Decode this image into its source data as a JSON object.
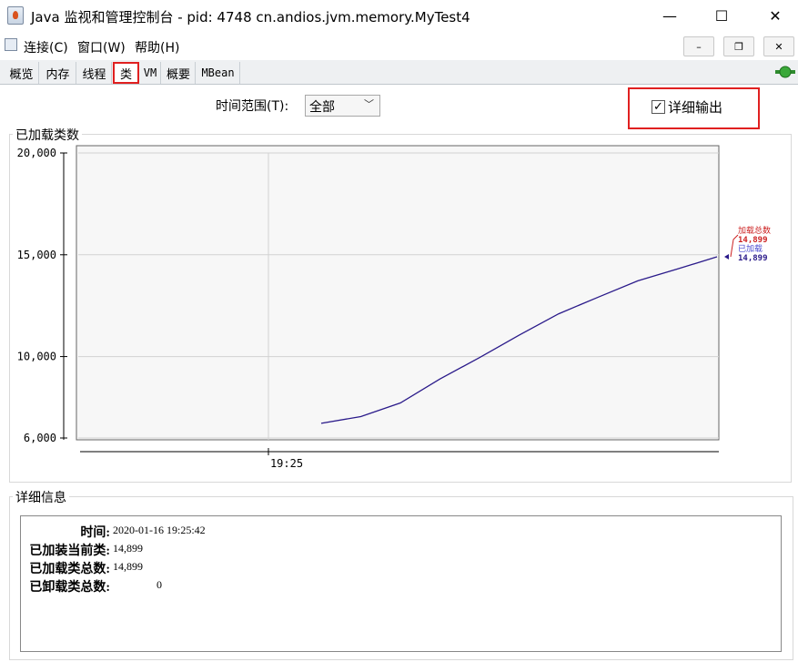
{
  "window": {
    "title": "Java 监视和管理控制台 - pid: 4748 cn.andios.jvm.memory.MyTest4",
    "minimize": "—",
    "maximize": "☐",
    "close": "✕"
  },
  "menubar": {
    "items": [
      "连接(C)",
      "窗口(W)",
      "帮助(H)"
    ],
    "mdi_minimize": "–",
    "mdi_restore": "❐",
    "mdi_close": "✕"
  },
  "tabs": [
    {
      "label": "概览"
    },
    {
      "label": "内存"
    },
    {
      "label": "线程"
    },
    {
      "label": "类"
    },
    {
      "label": "VM"
    },
    {
      "label": "概要"
    },
    {
      "label": "MBean"
    }
  ],
  "toolbar": {
    "range_label": "时间范围(T):",
    "range_value": "全部",
    "verbose_label": "详细输出",
    "verbose_checked": "✓"
  },
  "chart_group_title": "已加载类数",
  "chart_data": {
    "type": "line",
    "ylim": [
      6000,
      20000
    ],
    "yticks": [
      {
        "value": 20000,
        "label": "20,000"
      },
      {
        "value": 15000,
        "label": "15,000"
      },
      {
        "value": 10000,
        "label": "10,000"
      },
      {
        "value": 6000,
        "label": "6,000"
      }
    ],
    "xticks": [
      "19:25"
    ],
    "series": [
      {
        "name": "加载总数",
        "color": "#cc2222",
        "last_label": "14,899"
      },
      {
        "name": "已加载",
        "color": "#2a1a8a",
        "last_label": "14,899"
      }
    ],
    "values": [
      6720,
      7050,
      7720,
      8900,
      9950,
      11050,
      12100,
      12920,
      13720,
      14300,
      14899
    ]
  },
  "details_group_title": "详细信息",
  "details": [
    {
      "label": "时间:",
      "value": "2020-01-16 19:25:42"
    },
    {
      "label": "已加装当前类:",
      "value": "14,899"
    },
    {
      "label": "已加载类总数:",
      "value": "14,899"
    },
    {
      "label": "已卸载类总数:",
      "value": "0"
    }
  ]
}
